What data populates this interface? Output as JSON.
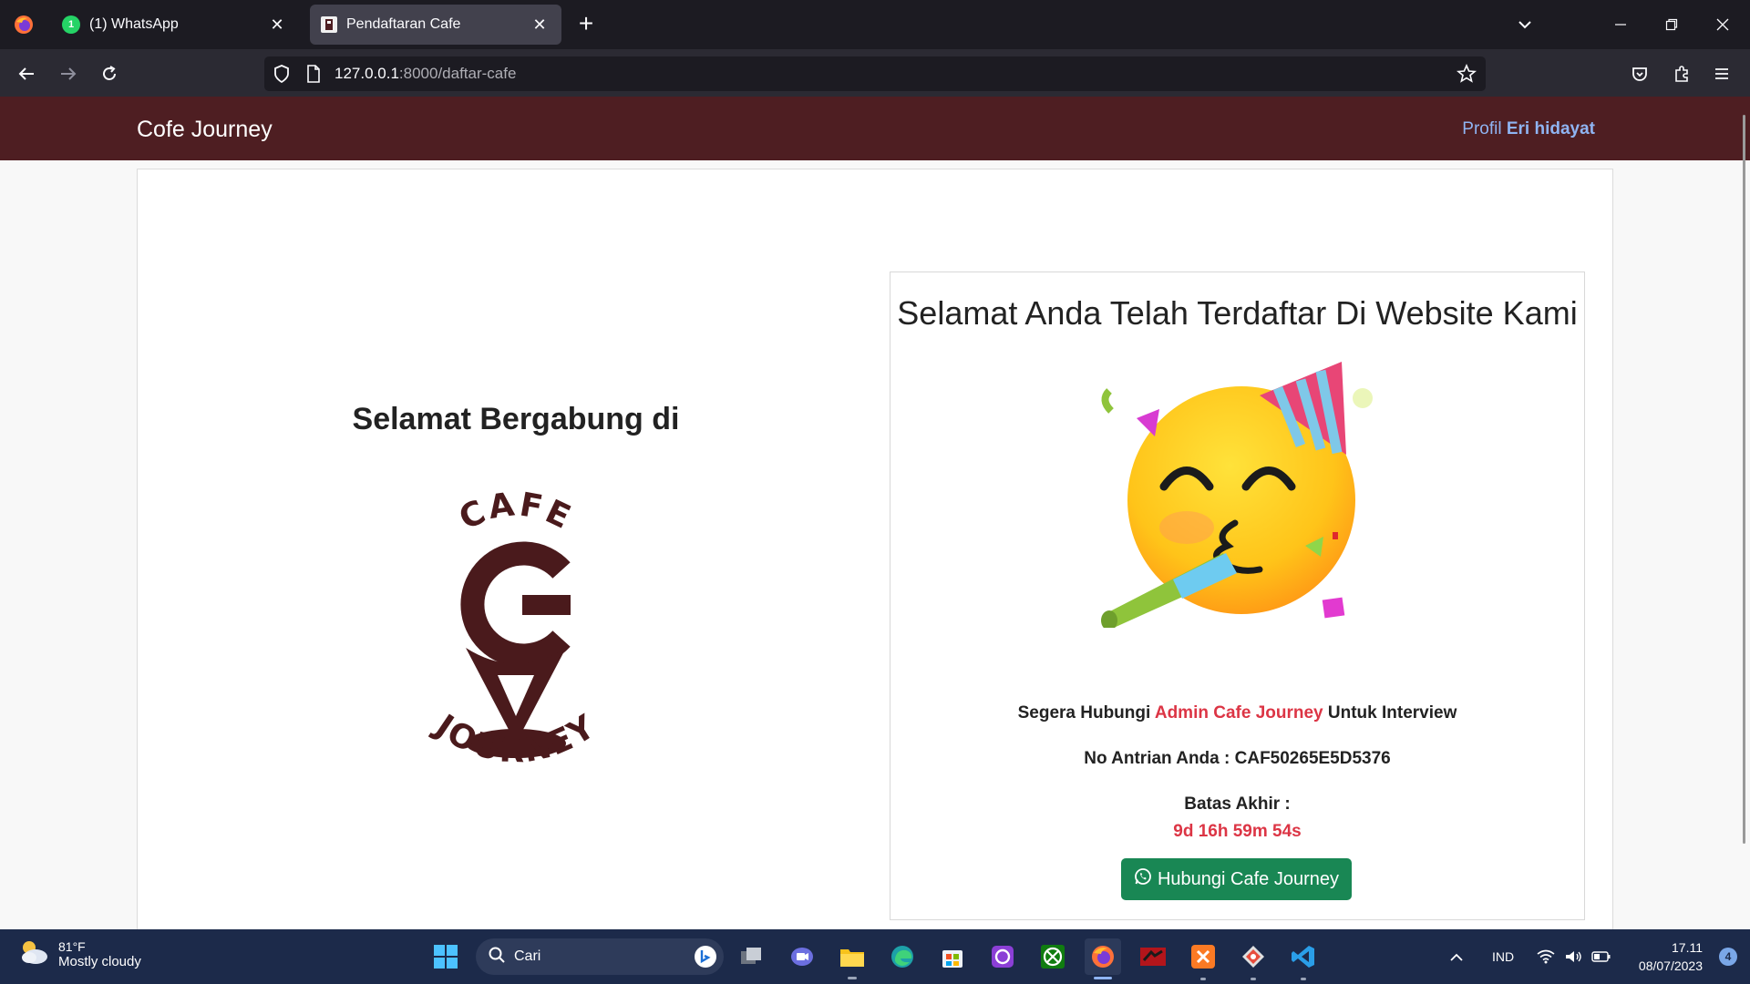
{
  "browser": {
    "tabs": [
      {
        "title": "(1) WhatsApp",
        "badge": "1",
        "favicon_color": "#25d366"
      },
      {
        "title": "Pendaftaran Cafe",
        "active": true
      }
    ],
    "url": {
      "host": "127.0.0.1",
      "rest": ":8000/daftar-cafe"
    }
  },
  "site": {
    "brand": "Cofe Journey",
    "profile_label": "Profil",
    "profile_name": "Eri hidayat",
    "header_color": "#4e1e22"
  },
  "main": {
    "welcome_title": "Selamat Bergabung di",
    "logo": {
      "top_text": "CAFE",
      "bottom_text": "JOURNEY"
    },
    "success": {
      "title": "Selamat Anda Telah Terdaftar Di Website Kami",
      "contact_prefix": "Segera Hubungi",
      "contact_highlight": "Admin Cafe Journey",
      "contact_suffix": "Untuk Interview",
      "queue_label": "No Antrian Anda :",
      "queue_number": "CAF50265E5D5376",
      "deadline_label": "Batas Akhir :",
      "countdown": "9d 16h 59m 54s",
      "button_label": "Hubungi Cafe Journey"
    }
  },
  "taskbar": {
    "weather_temp": "81°F",
    "weather_desc": "Mostly cloudy",
    "search_placeholder": "Cari",
    "language": "IND",
    "time": "17.11",
    "date": "08/07/2023",
    "notifications": "4"
  }
}
